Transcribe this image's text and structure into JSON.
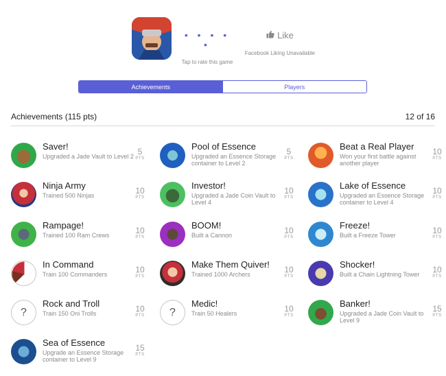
{
  "header": {
    "app_icon_name": "game-app-icon",
    "rating_dots": "• • • • •",
    "rate_caption": "Tap to rate this game",
    "like_label": "Like",
    "like_caption": "Facebook Liking Unavailable",
    "accent_color": "#5a5fd6"
  },
  "tabs": [
    {
      "label": "Achievements",
      "active": true
    },
    {
      "label": "Players",
      "active": false
    }
  ],
  "section": {
    "title": "Achievements (115 pts)",
    "count": "12 of 16"
  },
  "pts_label": "PTS",
  "achievements": [
    {
      "title": "Saver!",
      "desc": "Upgraded a Jade Vault to Level 2",
      "pts": "5",
      "art": "green"
    },
    {
      "title": "Pool of Essence",
      "desc": "Upgraded an Essence Storage container to Level 2",
      "pts": "5",
      "art": "blue"
    },
    {
      "title": "Beat a Real Player",
      "desc": "Won your first battle against another player",
      "pts": "10",
      "art": "orange"
    },
    {
      "title": "Ninja Army",
      "desc": "Trained 500 Ninjas",
      "pts": "10",
      "art": "red"
    },
    {
      "title": "Investor!",
      "desc": "Upgraded a Jade Coin Vault to Level 4",
      "pts": "10",
      "art": "greencoin"
    },
    {
      "title": "Lake of Essence",
      "desc": "Upgraded an Essence Storage container to Level 4",
      "pts": "10",
      "art": "bluelake"
    },
    {
      "title": "Rampage!",
      "desc": "Trained 100 Ram Crews",
      "pts": "10",
      "art": "ram"
    },
    {
      "title": "BOOM!",
      "desc": "Built a Cannon",
      "pts": "10",
      "art": "cannon"
    },
    {
      "title": "Freeze!",
      "desc": "Built a Freeze Tower",
      "pts": "10",
      "art": "freeze"
    },
    {
      "title": "In Command",
      "desc": "Train 100 Commanders",
      "pts": "10",
      "art": "partial"
    },
    {
      "title": "Make Them Quiver!",
      "desc": "Trained 1000 Archers",
      "pts": "10",
      "art": "archer"
    },
    {
      "title": "Shocker!",
      "desc": "Built a Chain Lightning Tower",
      "pts": "10",
      "art": "chain"
    },
    {
      "title": "Rock and Troll",
      "desc": "Train 150 Oni Trolls",
      "pts": "10",
      "art": "unknown"
    },
    {
      "title": "Medic!",
      "desc": "Train 50 Healers",
      "pts": "10",
      "art": "unknown"
    },
    {
      "title": "Banker!",
      "desc": "Upgraded a Jade Coin Vault to Level 9",
      "pts": "15",
      "art": "banker"
    },
    {
      "title": "Sea of Essence",
      "desc": "Upgrade an Essence Storage container to Level 9",
      "pts": "15",
      "art": "essence"
    }
  ]
}
